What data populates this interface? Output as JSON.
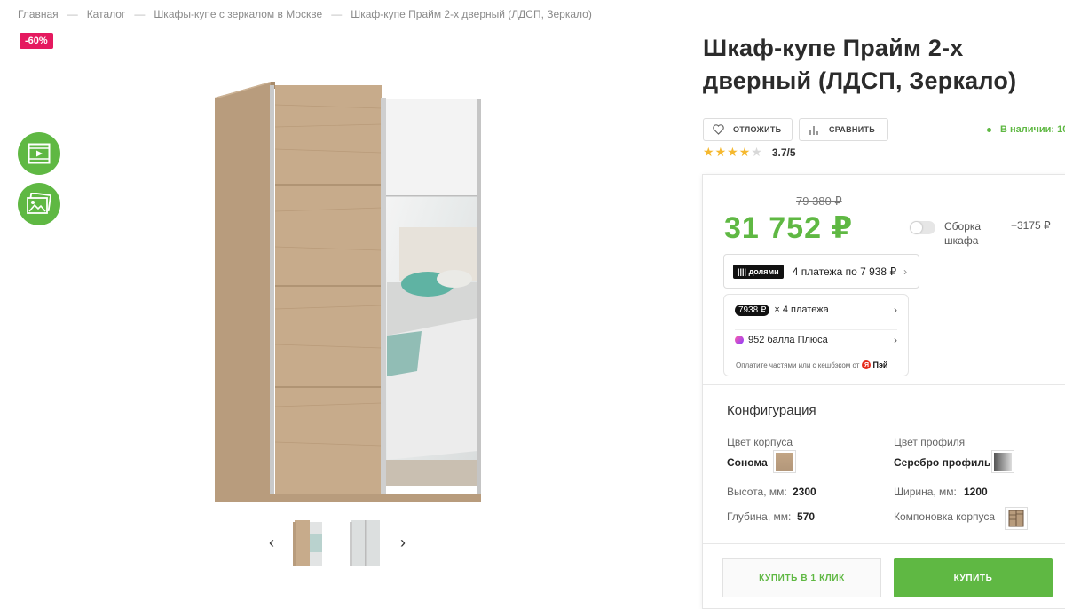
{
  "breadcrumb": {
    "items": [
      "Главная",
      "Каталог",
      "Шкафы-купе с зеркалом в Москве",
      "Шкаф-купе Прайм 2-х дверный (ЛДСП, Зеркало)"
    ],
    "separator": "—"
  },
  "badge": {
    "discount": "-60%"
  },
  "media": {
    "video_icon": "video-play-icon",
    "photo_icon": "image-gallery-icon"
  },
  "gallery": {
    "prev": "‹",
    "next": "›",
    "thumbnails_count": 2,
    "active_index": 0
  },
  "product": {
    "title": "Шкаф-купе Прайм 2-х дверный (ЛДСП, Зеркало)",
    "favorite_label": "ОТЛОЖИТЬ",
    "compare_label": "СРАВНИТЬ",
    "stock": "В наличии: 10",
    "rating": {
      "value": 3.7,
      "max": 5,
      "label": "3.7/5"
    }
  },
  "price": {
    "old": "79 380 ₽",
    "current": "31 752 ₽",
    "assembly_label": "Сборка шкафа",
    "assembly_price": "+3175 ₽",
    "assembly_enabled": false
  },
  "installments": {
    "dolyami_logo": "|||| долями",
    "dolyami_text": "4 платежа по 7 938 ₽",
    "split_amount": "7938 ₽",
    "split_text": "× 4 платежа",
    "plus_text": "952 балла Плюса",
    "footer_text": "Оплатите частями или с кешбэком от",
    "pay_brand": "Пэй"
  },
  "config": {
    "title": "Конфигурация",
    "body_color_label": "Цвет корпуса",
    "body_color_value": "Сонома",
    "profile_color_label": "Цвет профиля",
    "profile_color_value": "Серебро профиль",
    "height_label": "Высота, мм:",
    "height_value": "2300",
    "width_label": "Ширина, мм:",
    "width_value": "1200",
    "depth_label": "Глубина, мм:",
    "depth_value": "570",
    "layout_label": "Компоновка корпуса"
  },
  "actions": {
    "buy_one_click": "КУПИТЬ В 1 КЛИК",
    "buy": "КУПИТЬ"
  },
  "colors": {
    "accent": "#5fb843",
    "badge": "#e5195f",
    "star": "#f5b82e",
    "sonoma": "#c2a585"
  }
}
